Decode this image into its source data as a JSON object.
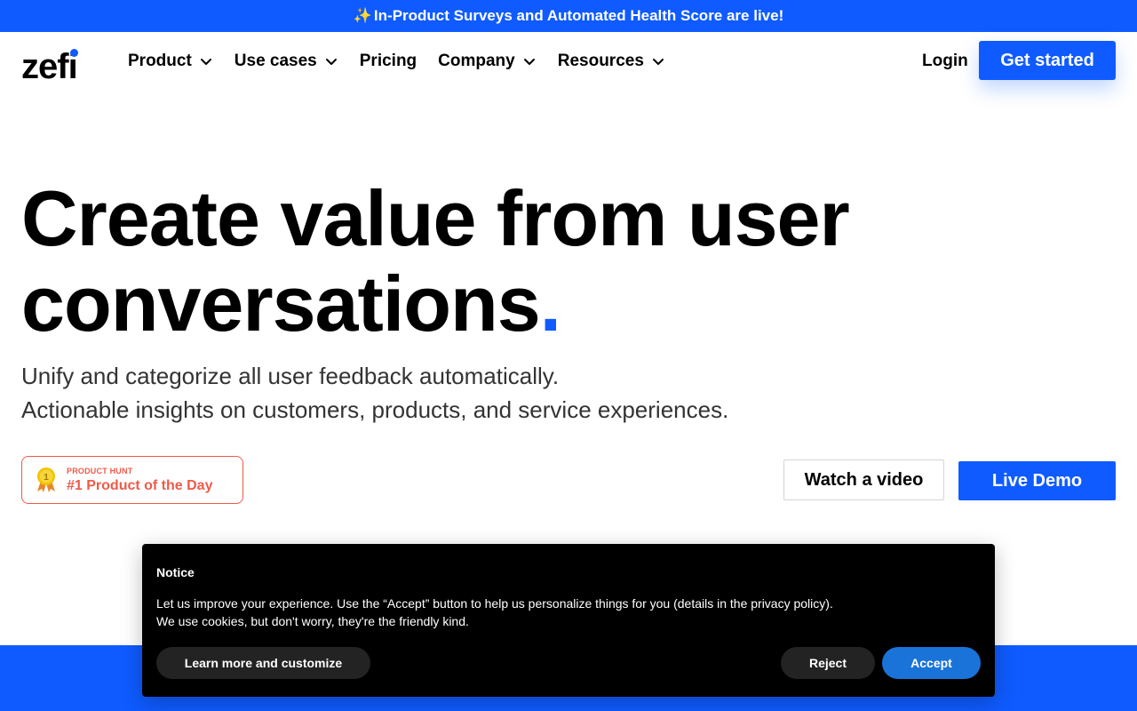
{
  "announcement": {
    "icon": "sparkles-icon",
    "sparkle": "✨",
    "text": "In-Product Surveys and Automated Health Score are live!"
  },
  "nav": {
    "logo": "zefi",
    "items": [
      {
        "label": "Product",
        "has_dropdown": true
      },
      {
        "label": "Use cases",
        "has_dropdown": true
      },
      {
        "label": "Pricing",
        "has_dropdown": false
      },
      {
        "label": "Company",
        "has_dropdown": true
      },
      {
        "label": "Resources",
        "has_dropdown": true
      }
    ],
    "login": "Login",
    "cta": "Get started"
  },
  "hero": {
    "title_line1": "Create value from user",
    "title_line2": "conversations",
    "title_period": ".",
    "subtitle_line1": "Unify and categorize all user feedback automatically.",
    "subtitle_line2": "Actionable insights on customers, products, and service experiences."
  },
  "badge": {
    "icon": "medal-icon",
    "medal_number": "1",
    "small_text": "PRODUCT HUNT",
    "big_text": "#1 Product of the Day"
  },
  "actions": {
    "watch": "Watch a video",
    "demo": "Live Demo"
  },
  "notice": {
    "title": "Notice",
    "body_line1": "Let us improve your experience. Use the “Accept” button to help us personalize things for you (details in the privacy policy).",
    "body_line2": "We use cookies, but don't worry, they're the friendly kind.",
    "learn_more": "Learn more and customize",
    "reject": "Reject",
    "accept": "Accept"
  },
  "colors": {
    "brand": "#0f5bff",
    "badge": "#ef5a4a",
    "accept": "#1a73d9"
  }
}
